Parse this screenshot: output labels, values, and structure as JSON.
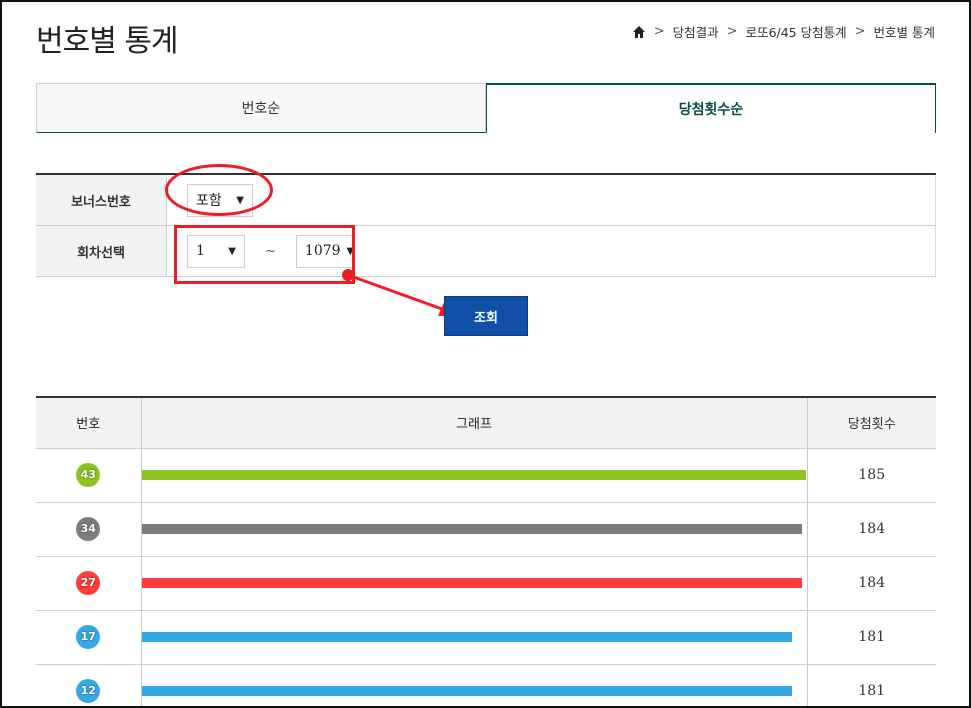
{
  "page": {
    "title": "번호별 통계"
  },
  "breadcrumb": {
    "icon": "home-icon",
    "items": [
      "당첨결과",
      "로또6/45 당첨통계",
      "번호별 통계"
    ]
  },
  "tabs": [
    {
      "label": "번호순",
      "active": false
    },
    {
      "label": "당첨횟수순",
      "active": true
    }
  ],
  "filter": {
    "bonus_label": "보너스번호",
    "bonus_value": "포함",
    "round_label": "회차선택",
    "round_from": "1",
    "round_tilde": "~",
    "round_to": "1079"
  },
  "search_label": "조회",
  "table": {
    "headers": {
      "number": "번호",
      "graph": "그래프",
      "count": "당첨횟수"
    },
    "max_count": 185,
    "rows": [
      {
        "number": "43",
        "count": "185",
        "value": 185,
        "color": "#8dc21f"
      },
      {
        "number": "34",
        "count": "184",
        "value": 184,
        "color": "#7d7d7d"
      },
      {
        "number": "27",
        "count": "184",
        "value": 184,
        "color": "#ff3c3c"
      },
      {
        "number": "17",
        "count": "181",
        "value": 181,
        "color": "#35a8e8"
      },
      {
        "number": "12",
        "count": "181",
        "value": 181,
        "color": "#35a8e8"
      }
    ]
  },
  "colors": {
    "accent": "#0a4d4d",
    "button": "#0f4fa8",
    "annotation": "#ee1c24"
  }
}
